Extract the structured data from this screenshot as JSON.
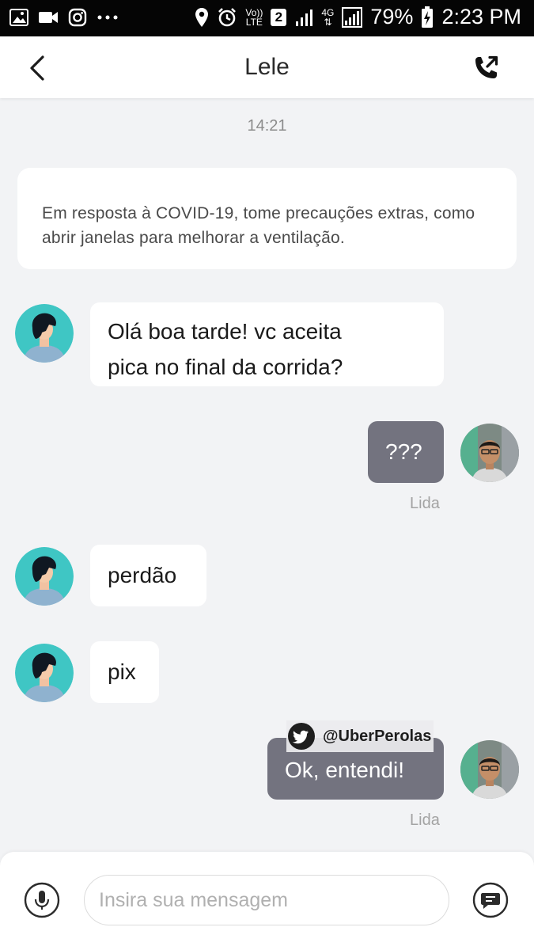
{
  "status_bar": {
    "battery": "79%",
    "time": "2:23 PM",
    "volte_top": "Vo))",
    "volte_bottom": "LTE",
    "sim_number": "2",
    "network": "4G"
  },
  "header": {
    "contact_name": "Lele"
  },
  "conversation": {
    "timestamp": "14:21",
    "notice": "Em resposta à COVID-19, tome precauções extras, como abrir janelas para melhorar a ventilação.",
    "messages": [
      {
        "from": "driver",
        "line1": "Olá boa tarde! vc aceita",
        "line2": "pica no final da corrida?"
      },
      {
        "from": "me",
        "text": "???",
        "status": "Lida"
      },
      {
        "from": "driver",
        "text": "perdão"
      },
      {
        "from": "driver",
        "text": "pix"
      },
      {
        "from": "me",
        "text": "Ok, entendi!",
        "status": "Lida"
      }
    ]
  },
  "watermark": {
    "handle": "@UberPerolas",
    "icon": "twitter-bird-icon"
  },
  "composer": {
    "placeholder": "Insira sua mensagem"
  },
  "colors": {
    "outgoing_bubble": "#73737f",
    "avatar_teal": "#3fc6c4",
    "background": "#f2f3f5"
  }
}
